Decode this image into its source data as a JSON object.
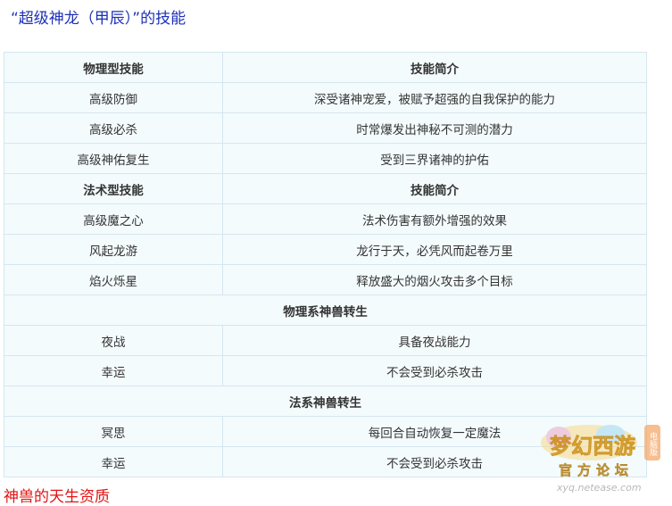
{
  "title": "“超级神龙（甲辰）”的技能",
  "table": {
    "rows": [
      {
        "type": "header",
        "cells": [
          "物理型技能",
          "技能简介"
        ]
      },
      {
        "type": "row",
        "cells": [
          "高级防御",
          "深受诸神宠爱，被赋予超强的自我保护的能力"
        ]
      },
      {
        "type": "row",
        "cells": [
          "高级必杀",
          "时常爆发出神秘不可测的潜力"
        ]
      },
      {
        "type": "row",
        "cells": [
          "高级神佑复生",
          "受到三界诸神的护佑"
        ]
      },
      {
        "type": "header",
        "cells": [
          "法术型技能",
          "技能简介"
        ]
      },
      {
        "type": "row",
        "cells": [
          "高级魔之心",
          "法术伤害有额外增强的效果"
        ]
      },
      {
        "type": "row",
        "cells": [
          "风起龙游",
          "龙行于天，必凭风而起卷万里"
        ]
      },
      {
        "type": "row",
        "cells": [
          "焰火烁星",
          "释放盛大的烟火攻击多个目标"
        ]
      },
      {
        "type": "section",
        "cells": [
          "物理系神兽转生"
        ]
      },
      {
        "type": "row",
        "cells": [
          "夜战",
          "具备夜战能力"
        ]
      },
      {
        "type": "row",
        "cells": [
          "幸运",
          "不会受到必杀攻击"
        ]
      },
      {
        "type": "section",
        "cells": [
          "法系神兽转生"
        ]
      },
      {
        "type": "row",
        "cells": [
          "冥思",
          "每回合自动恢复一定魔法"
        ]
      },
      {
        "type": "row",
        "cells": [
          "幸运",
          "不会受到必杀攻击"
        ]
      }
    ]
  },
  "footer_title": "神兽的天生资质",
  "watermark": {
    "logo_text": "梦幻西游",
    "badge_text": "电脑版",
    "subtitle": "官方论坛",
    "url": "xyq.netease.com"
  },
  "colors": {
    "title": "#1d2fb8",
    "footer_title": "#e21414",
    "cell_bg": "#f4fbfd",
    "border": "#d5e6ef"
  }
}
